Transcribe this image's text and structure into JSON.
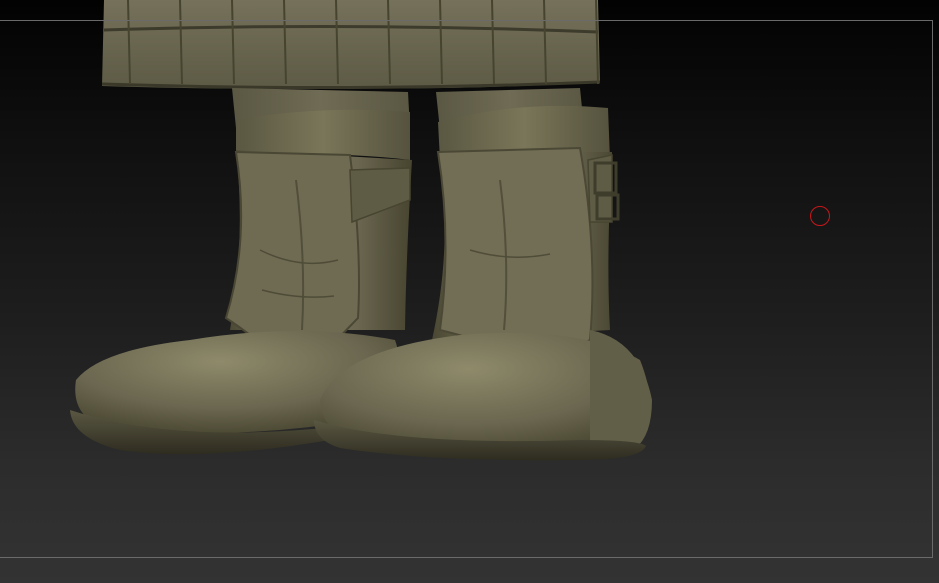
{
  "canvas": {
    "background_top": "#020202",
    "background_bottom": "#333333",
    "frame_color": "#6a6a6a"
  },
  "model": {
    "material_base": "#6d6a4f",
    "material_highlight": "#8e8a6a",
    "material_shadow": "#3f3d2c",
    "parts": [
      "coat-hem",
      "left-boot",
      "right-boot",
      "boot-buckle"
    ]
  },
  "brush_cursor": {
    "color": "#c8161b",
    "icon": "brush-circle-icon"
  }
}
